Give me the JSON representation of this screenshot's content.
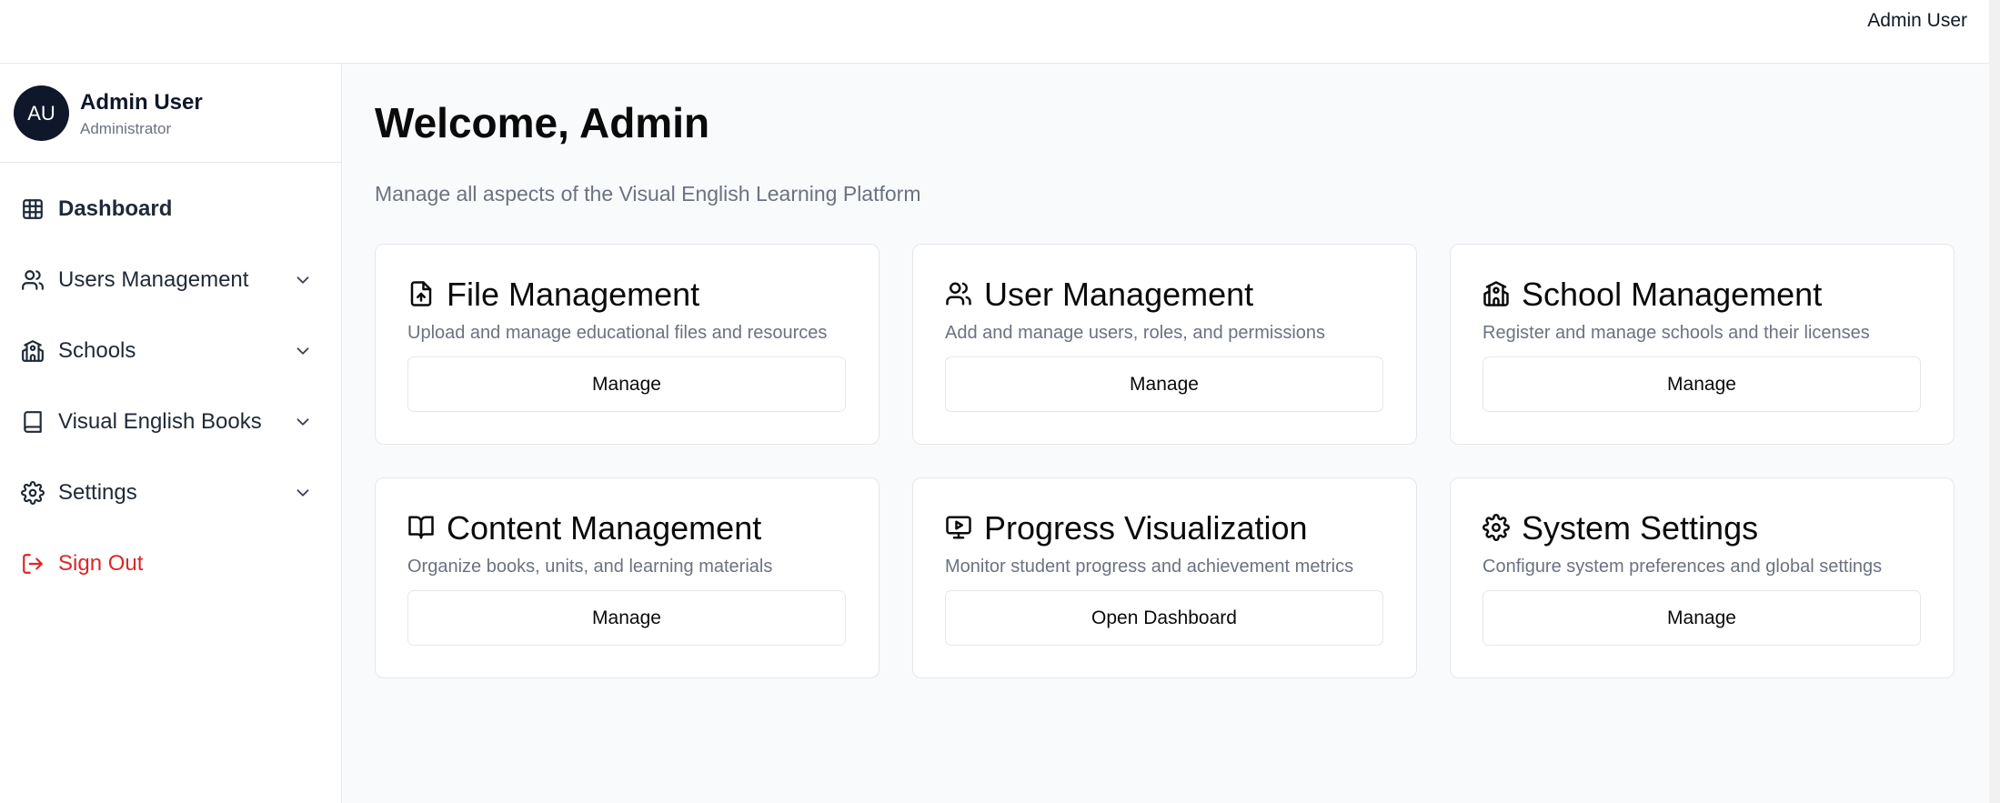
{
  "header": {
    "user_name": "Admin User"
  },
  "sidebar": {
    "profile": {
      "initials": "AU",
      "name": "Admin User",
      "role": "Administrator"
    },
    "items": [
      {
        "label": "Dashboard",
        "icon": "grid-icon",
        "active": true,
        "expandable": false
      },
      {
        "label": "Users Management",
        "icon": "users-icon",
        "expandable": true
      },
      {
        "label": "Schools",
        "icon": "school-icon",
        "expandable": true
      },
      {
        "label": "Visual English Books",
        "icon": "book-icon",
        "expandable": true
      },
      {
        "label": "Settings",
        "icon": "gear-icon",
        "expandable": true
      },
      {
        "label": "Sign Out",
        "icon": "sign-out-icon",
        "expandable": false
      }
    ]
  },
  "main": {
    "title": "Welcome, Admin",
    "subtitle": "Manage all aspects of the Visual English Learning Platform",
    "cards": [
      {
        "title": "File Management",
        "description": "Upload and manage educational files and resources",
        "button": "Manage",
        "icon": "file-upload-icon"
      },
      {
        "title": "User Management",
        "description": "Add and manage users, roles, and permissions",
        "button": "Manage",
        "icon": "users-icon"
      },
      {
        "title": "School Management",
        "description": "Register and manage schools and their licenses",
        "button": "Manage",
        "icon": "school-icon"
      },
      {
        "title": "Content Management",
        "description": "Organize books, units, and learning materials",
        "button": "Manage",
        "icon": "open-book-icon"
      },
      {
        "title": "Progress Visualization",
        "description": "Monitor student progress and achievement metrics",
        "button": "Open Dashboard",
        "icon": "monitor-play-icon"
      },
      {
        "title": "System Settings",
        "description": "Configure system preferences and global settings",
        "button": "Manage",
        "icon": "gear-icon"
      }
    ]
  },
  "colors": {
    "accent_dark": "#0f172a",
    "danger": "#dc2626",
    "muted": "#6b7280",
    "background": "#f9fafb"
  }
}
